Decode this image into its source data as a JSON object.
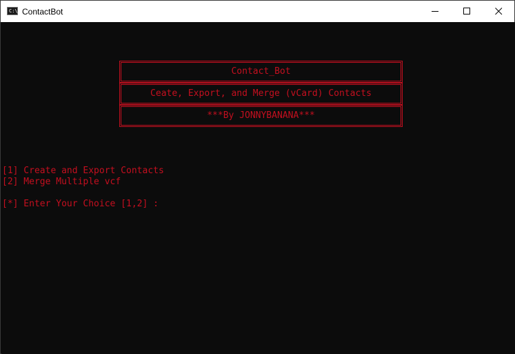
{
  "window": {
    "title": "ContactBot",
    "icon": "cmd-icon",
    "icon_glyph": "C:\\"
  },
  "title_buttons": {
    "minimize_icon": "minimize-icon",
    "maximize_icon": "maximize-icon",
    "close_icon": "close-icon"
  },
  "banner": {
    "name": "Contact_Bot",
    "tagline": "Ceate, Export, and Merge (vCard) Contacts",
    "author": "***By JONNYBANANA***"
  },
  "menu": {
    "option1": "[1] Create and Export Contacts",
    "option2": "[2] Merge Multiple vcf",
    "prompt": "[*] Enter Your Choice [1,2] :"
  },
  "colors": {
    "console_background": "#0c0c0c",
    "console_text": "#c50f1f",
    "titlebar_background": "#ffffff"
  }
}
